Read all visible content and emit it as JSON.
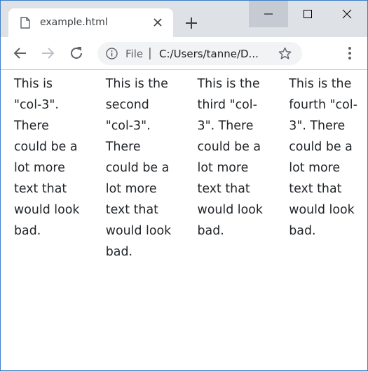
{
  "tab": {
    "title": "example.html"
  },
  "omnibox": {
    "scheme_label": "File",
    "separator": "|",
    "url": "C:/Users/tanne/D..."
  },
  "icons": {
    "tab_favicon": "page-icon",
    "tab_close": "close-icon",
    "new_tab": "plus-icon",
    "minimize": "minimize-icon",
    "maximize": "maximize-icon",
    "close_window": "close-icon",
    "back": "arrow-left-icon",
    "forward": "arrow-right-icon",
    "reload": "reload-icon",
    "info": "info-icon",
    "bookmark": "star-icon",
    "menu": "vertical-dots-icon"
  },
  "colors": {
    "window_border": "#3c7ec9",
    "titlebar": "#dee1e6",
    "omnibox": "#f1f3f4",
    "text": "#212529"
  },
  "columns": [
    {
      "text": "This is \"col-3\". There could be a lot more text that would look bad."
    },
    {
      "text": "This is the second \"col-3\". There could be a lot more text that would look bad."
    },
    {
      "text": "This is the third \"col-3\". There could be a lot more text that would look bad."
    },
    {
      "text": "This is the fourth \"col-3\". There could be a lot more text that would look bad."
    }
  ]
}
